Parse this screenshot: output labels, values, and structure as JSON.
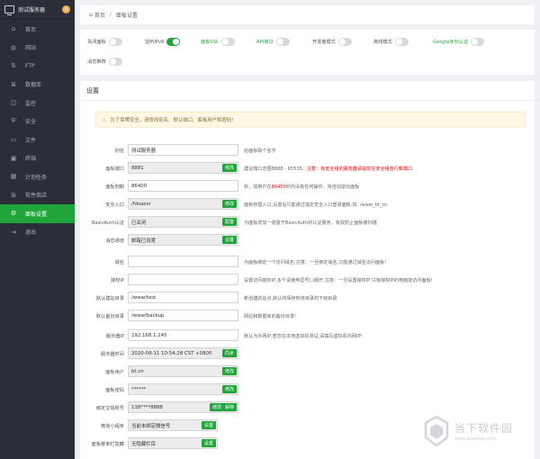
{
  "sidebar": {
    "brand": "测试服务器",
    "badge": "0",
    "items": [
      {
        "label": "首页",
        "icon": "home-icon",
        "glyph": "⌂"
      },
      {
        "label": "网站",
        "icon": "globe-icon",
        "glyph": "◍"
      },
      {
        "label": "FTP",
        "icon": "ftp-icon",
        "glyph": "⇅"
      },
      {
        "label": "数据库",
        "icon": "database-icon",
        "glyph": "≣"
      },
      {
        "label": "监控",
        "icon": "monitor-icon",
        "glyph": "◫"
      },
      {
        "label": "安全",
        "icon": "shield-icon",
        "glyph": "⛨"
      },
      {
        "label": "文件",
        "icon": "folder-icon",
        "glyph": "▭"
      },
      {
        "label": "终端",
        "icon": "terminal-icon",
        "glyph": "▣"
      },
      {
        "label": "计划任务",
        "icon": "calendar-icon",
        "glyph": "▦"
      },
      {
        "label": "软件商店",
        "icon": "apps-icon",
        "glyph": "⊞"
      },
      {
        "label": "面板设置",
        "icon": "gear-icon",
        "glyph": "⚙"
      },
      {
        "label": "退出",
        "icon": "logout-icon",
        "glyph": "⇥"
      }
    ]
  },
  "breadcrumb": {
    "home": "首页",
    "current": "面板设置"
  },
  "toggles": [
    {
      "label": "关闭面板",
      "on": false,
      "green": false
    },
    {
      "label": "监听IPv6",
      "on": true,
      "green": false
    },
    {
      "label": "面板SSL",
      "on": false,
      "green": true
    },
    {
      "label": "API接口",
      "on": false,
      "green": true
    },
    {
      "label": "开发者模式",
      "on": false,
      "green": false
    },
    {
      "label": "离线模式",
      "on": false,
      "green": false
    },
    {
      "label": "Google身份认证",
      "on": false,
      "green": true
    },
    {
      "label": "消息推荐",
      "on": false,
      "green": false
    }
  ],
  "settings": {
    "title": "设置",
    "notice": "为了保障安全，请修改别名、默认端口、面板用户和密码!",
    "rows": [
      {
        "label": "别名",
        "value": "测试服务器",
        "gray": false,
        "btn": "",
        "desc": "给面板取个名字"
      },
      {
        "label": "面板端口",
        "value": "8881",
        "gray": true,
        "btn": "修改",
        "desc": "建议端口范围8888 - 65535，",
        "desc_red": "注意：有安全组的服务器请提前在安全组放行新端口"
      },
      {
        "label": "面板到期",
        "value": "86400",
        "gray": false,
        "btn": "",
        "desc": "秒，如用户在",
        "desc_mid_red": "86400",
        "desc_tail": "秒内没有任何操作，将自动退出面板"
      },
      {
        "label": "安全入口",
        "value": "/fdsaexr",
        "gray": true,
        "btn": "修改",
        "desc": "面板管理入口,设置后只能通过指定安全入口登录面板,如: /www_bt_cn"
      },
      {
        "label": "BasicAuth认证",
        "value": "已关闭",
        "gray": true,
        "btn": "配置",
        "desc": "为面板增加一道基于BasicAuth的认证服务，有效防止面板被扫描"
      },
      {
        "label": "消息通道",
        "value": "邮箱已设置",
        "gray": true,
        "btn": "设置",
        "desc": ""
      },
      {
        "label": "域名",
        "value": "",
        "gray": false,
        "btn": "",
        "desc": "为面板绑定一个访问域名;注意：一旦绑定域名,只能通过域名访问面板!"
      },
      {
        "label": "授权IP",
        "value": "",
        "gray": false,
        "btn": "",
        "desc": "设置访问授权IP,多个请使用逗号(,)隔开,注意：一旦设置授权IP,只有授权IP的电脑能访问面板!"
      },
      {
        "label": "默认建站目录",
        "value": "/www/test",
        "gray": false,
        "btn": "",
        "desc": "新创建的站点,默认将保存到该目录的下级目录"
      },
      {
        "label": "默认备份目录",
        "value": "/www/backup",
        "gray": false,
        "btn": "",
        "desc": "网站和数据库的备份目录!"
      },
      {
        "label": "服务器IP",
        "value": "192.168.1.245",
        "gray": false,
        "btn": "",
        "desc": "默认为外网IP,若您在本地虚拟机测试,请填写虚拟机内网IP!"
      },
      {
        "label": "服务器时间",
        "value": "2020-09-11 10:54:28 CST +0800",
        "gray": true,
        "btn": "同步",
        "desc": ""
      },
      {
        "label": "面板用户",
        "value": "bt.cn",
        "gray": true,
        "btn": "修改",
        "desc": ""
      },
      {
        "label": "面板密码",
        "value": "******",
        "gray": true,
        "btn": "修改",
        "desc": ""
      },
      {
        "label": "绑定宝塔账号",
        "value": "138****8888",
        "gray": true,
        "btn": "修改",
        "btn_extra": "解绑",
        "desc": ""
      },
      {
        "label": "微信小程序",
        "value": "当前未绑定微信号",
        "gray": true,
        "btn": "设置",
        "desc": ""
      },
      {
        "label": "面板菜单栏隐藏",
        "value": "无隐藏栏目",
        "gray": true,
        "btn": "设置",
        "desc": ""
      }
    ]
  },
  "watermark": {
    "name": "当下软件园",
    "url": "www.downxia.com"
  }
}
